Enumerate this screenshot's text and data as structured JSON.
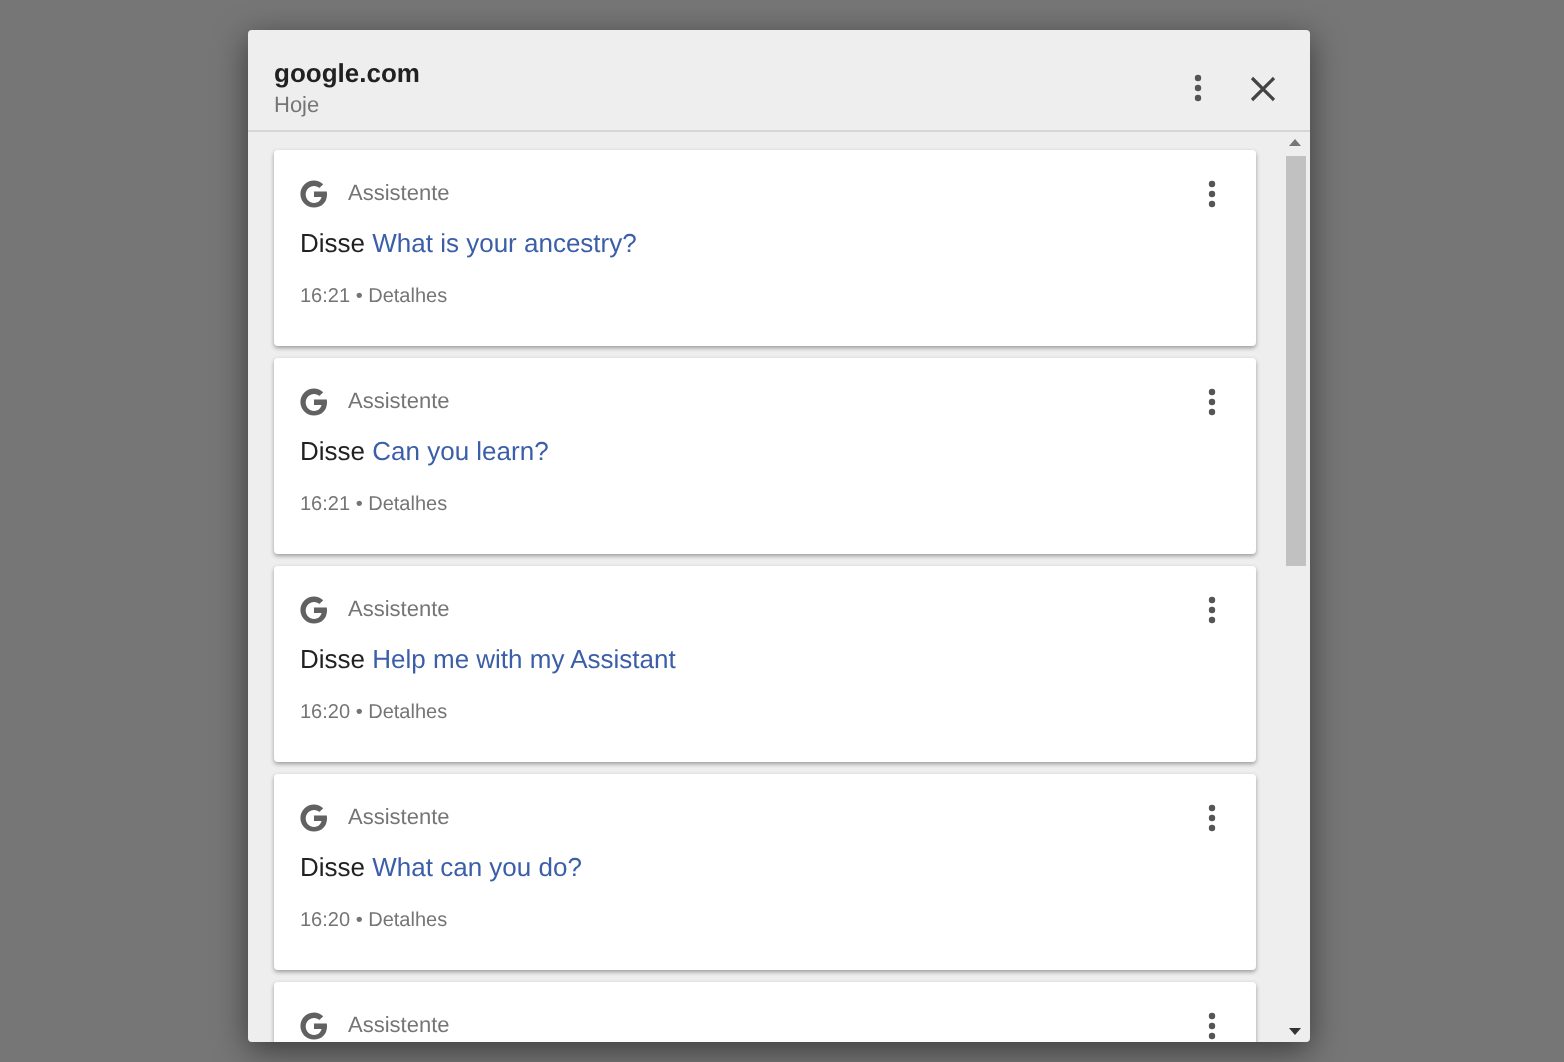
{
  "dialog": {
    "title": "google.com",
    "subtitle": "Hoje"
  },
  "cards": [
    {
      "source": "Assistente",
      "verb": "Disse",
      "query": "What is your ancestry?",
      "time": "16:21",
      "separator": "•",
      "details": "Detalhes"
    },
    {
      "source": "Assistente",
      "verb": "Disse",
      "query": "Can you learn?",
      "time": "16:21",
      "separator": "•",
      "details": "Detalhes"
    },
    {
      "source": "Assistente",
      "verb": "Disse",
      "query": "Help me with my Assistant",
      "time": "16:20",
      "separator": "•",
      "details": "Detalhes"
    },
    {
      "source": "Assistente",
      "verb": "Disse",
      "query": "What can you do?",
      "time": "16:20",
      "separator": "•",
      "details": "Detalhes"
    },
    {
      "source": "Assistente"
    }
  ]
}
